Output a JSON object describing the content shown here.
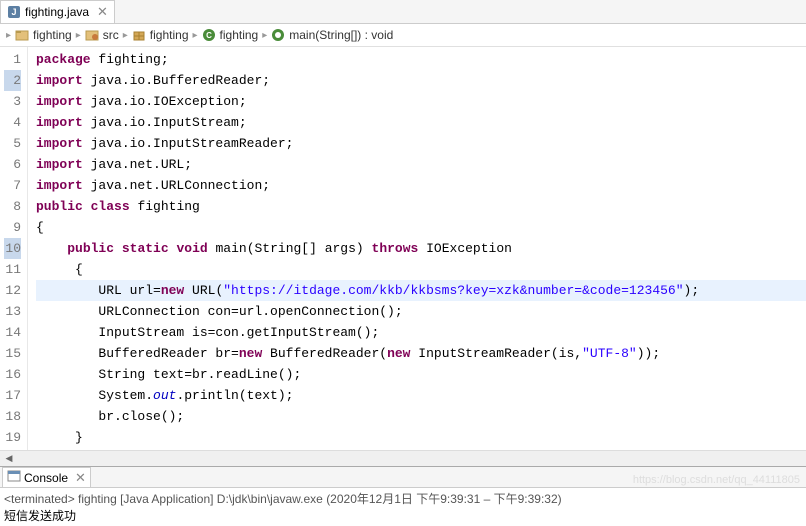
{
  "tab": {
    "filename": "fighting.java"
  },
  "breadcrumb": {
    "project": "fighting",
    "src": "src",
    "package": "fighting",
    "class": "fighting",
    "method": "main(String[]) : void"
  },
  "code": {
    "lines": [
      {
        "n": "1",
        "tokens": [
          [
            "kw",
            "package"
          ],
          [
            "",
            " fighting;"
          ]
        ]
      },
      {
        "n": "2",
        "marker": true,
        "tokens": [
          [
            "kw",
            "import"
          ],
          [
            "",
            " java.io.BufferedReader;"
          ]
        ]
      },
      {
        "n": "3",
        "tokens": [
          [
            "kw",
            "import"
          ],
          [
            "",
            " java.io.IOException;"
          ]
        ]
      },
      {
        "n": "4",
        "tokens": [
          [
            "kw",
            "import"
          ],
          [
            "",
            " java.io.InputStream;"
          ]
        ]
      },
      {
        "n": "5",
        "tokens": [
          [
            "kw",
            "import"
          ],
          [
            "",
            " java.io.InputStreamReader;"
          ]
        ]
      },
      {
        "n": "6",
        "tokens": [
          [
            "kw",
            "import"
          ],
          [
            "",
            " java.net.URL;"
          ]
        ]
      },
      {
        "n": "7",
        "tokens": [
          [
            "kw",
            "import"
          ],
          [
            "",
            " java.net.URLConnection;"
          ]
        ]
      },
      {
        "n": "8",
        "tokens": [
          [
            "kw",
            "public"
          ],
          [
            "",
            " "
          ],
          [
            "kw",
            "class"
          ],
          [
            "",
            " fighting"
          ]
        ]
      },
      {
        "n": "9",
        "tokens": [
          [
            "",
            "{"
          ]
        ]
      },
      {
        "n": "10",
        "marker": true,
        "tokens": [
          [
            "",
            "    "
          ],
          [
            "kw",
            "public"
          ],
          [
            "",
            " "
          ],
          [
            "kw",
            "static"
          ],
          [
            "",
            " "
          ],
          [
            "kw",
            "void"
          ],
          [
            "",
            " main(String[] args) "
          ],
          [
            "kw",
            "throws"
          ],
          [
            "",
            " IOException"
          ]
        ]
      },
      {
        "n": "11",
        "tokens": [
          [
            "",
            "     {"
          ]
        ]
      },
      {
        "n": "12",
        "hl": true,
        "tokens": [
          [
            "",
            "        URL url="
          ],
          [
            "kw",
            "new"
          ],
          [
            "",
            " URL("
          ],
          [
            "str",
            "\"https://itdage.com/kkb/kkbsms?key=xzk&number=&code=123456\""
          ],
          [
            "",
            ");"
          ]
        ]
      },
      {
        "n": "13",
        "tokens": [
          [
            "",
            "        URLConnection con=url.openConnection();"
          ]
        ]
      },
      {
        "n": "14",
        "tokens": [
          [
            "",
            "        InputStream is=con.getInputStream();"
          ]
        ]
      },
      {
        "n": "15",
        "tokens": [
          [
            "",
            "        BufferedReader br="
          ],
          [
            "kw",
            "new"
          ],
          [
            "",
            " BufferedReader("
          ],
          [
            "kw",
            "new"
          ],
          [
            "",
            " InputStreamReader(is,"
          ],
          [
            "str",
            "\"UTF-8\""
          ],
          [
            "",
            "));"
          ]
        ]
      },
      {
        "n": "16",
        "tokens": [
          [
            "",
            "        String text=br.readLine();"
          ]
        ]
      },
      {
        "n": "17",
        "tokens": [
          [
            "",
            "        System."
          ],
          [
            "fld",
            "out"
          ],
          [
            "",
            ".println(text);"
          ]
        ]
      },
      {
        "n": "18",
        "tokens": [
          [
            "",
            "        br.close();"
          ]
        ]
      },
      {
        "n": "19",
        "tokens": [
          [
            "",
            "     }"
          ]
        ]
      }
    ]
  },
  "console": {
    "title": "Console",
    "status": "<terminated> fighting [Java Application] D:\\jdk\\bin\\javaw.exe  (2020年12月1日 下午9:39:31 – 下午9:39:32)",
    "output": "短信发送成功"
  },
  "watermark": "https://blog.csdn.net/qq_44111805"
}
